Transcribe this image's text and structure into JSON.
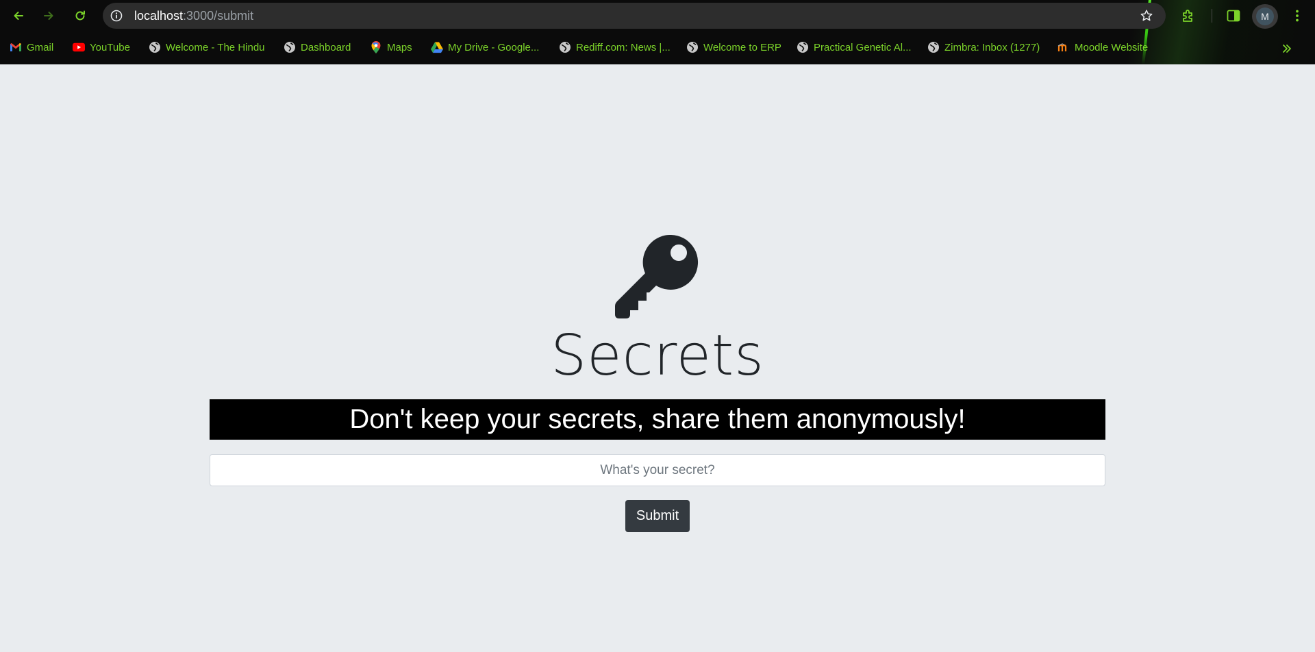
{
  "browser": {
    "url_host": "localhost",
    "url_rest": ":3000/submit",
    "avatar_initial": "M",
    "accent_color": "#7cd42a",
    "bookmarks": [
      {
        "label": "Gmail",
        "icon": "gmail-icon"
      },
      {
        "label": "YouTube",
        "icon": "youtube-icon"
      },
      {
        "label": "Welcome - The Hindu",
        "icon": "globe-icon"
      },
      {
        "label": "Dashboard",
        "icon": "globe-icon"
      },
      {
        "label": "Maps",
        "icon": "maps-icon"
      },
      {
        "label": "My Drive - Google...",
        "icon": "drive-icon"
      },
      {
        "label": "Rediff.com: News |...",
        "icon": "globe-icon"
      },
      {
        "label": "Welcome to ERP",
        "icon": "globe-icon"
      },
      {
        "label": "Practical Genetic Al...",
        "icon": "globe-icon"
      },
      {
        "label": "Zimbra: Inbox (1277)",
        "icon": "globe-icon"
      },
      {
        "label": "Moodle Website",
        "icon": "moodle-icon"
      }
    ]
  },
  "page": {
    "icon": "key-icon",
    "title": "Secrets",
    "banner": "Don't keep your secrets, share them anonymously!",
    "input_placeholder": "What's your secret?",
    "input_value": "",
    "submit_label": "Submit",
    "background_color": "#e9ecef",
    "button_color": "#343a40"
  }
}
